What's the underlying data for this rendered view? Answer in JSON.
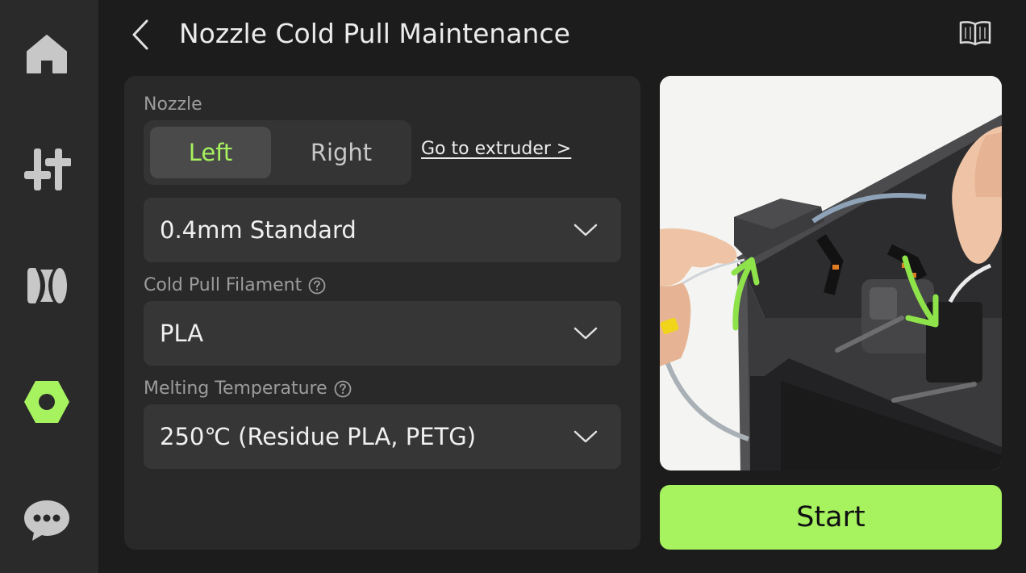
{
  "header": {
    "title": "Nozzle Cold Pull Maintenance"
  },
  "sidebar": {
    "items": [
      {
        "icon": "home-icon",
        "active": false
      },
      {
        "icon": "controls-icon",
        "active": false
      },
      {
        "icon": "filament-icon",
        "active": false
      },
      {
        "icon": "settings-nut-icon",
        "active": true
      },
      {
        "icon": "chat-icon",
        "active": false
      }
    ]
  },
  "nozzle": {
    "label": "Nozzle",
    "options": [
      "Left",
      "Right"
    ],
    "selected": "Left",
    "link_label": "Go to extruder >",
    "type_value": "0.4mm Standard"
  },
  "filament": {
    "label": "Cold Pull Filament",
    "value": "PLA"
  },
  "temperature": {
    "label": "Melting Temperature",
    "value": "250℃ (Residue PLA, PETG)"
  },
  "start_label": "Start",
  "colors": {
    "accent": "#a6f25f",
    "background": "#1c1c1c",
    "panel": "#292929"
  }
}
